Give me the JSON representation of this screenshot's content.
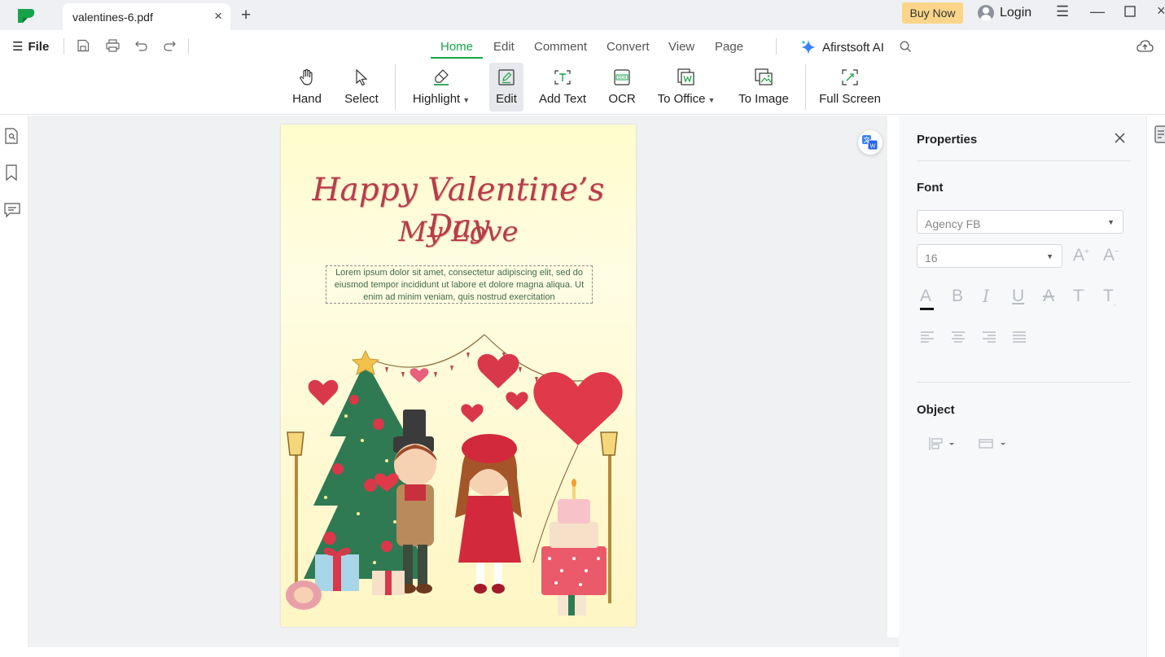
{
  "tab": {
    "title": "valentines-6.pdf"
  },
  "header": {
    "buy_now": "Buy Now",
    "login": "Login"
  },
  "menu": {
    "file": "File",
    "tabs": [
      "Home",
      "Edit",
      "Comment",
      "Convert",
      "View",
      "Page"
    ],
    "active_tab": "Home",
    "ai": "Afirstsoft AI"
  },
  "toolbar": {
    "hand": "Hand",
    "select": "Select",
    "highlight": "Highlight",
    "edit": "Edit",
    "add_text": "Add Text",
    "ocr": "OCR",
    "to_office": "To Office",
    "to_image": "To Image",
    "full_screen": "Full Screen",
    "selected_tool": "Edit"
  },
  "document": {
    "headline_1": "Happy Valentine’s Day",
    "headline_2": "My Love",
    "body": "Lorem ipsum dolor sit amet, consectetur adipiscing elit, sed do eiusmod tempor incididunt ut labore et dolore magna aliqua. Ut enim ad minim veniam, quis nostrud exercitation"
  },
  "properties": {
    "title": "Properties",
    "font_section": "Font",
    "font_family": "Agency FB",
    "font_size": "16",
    "object_section": "Object"
  },
  "colors": {
    "accent": "#17a34a",
    "buy_bg": "#fbd68a",
    "headline": "#b83c4a"
  }
}
